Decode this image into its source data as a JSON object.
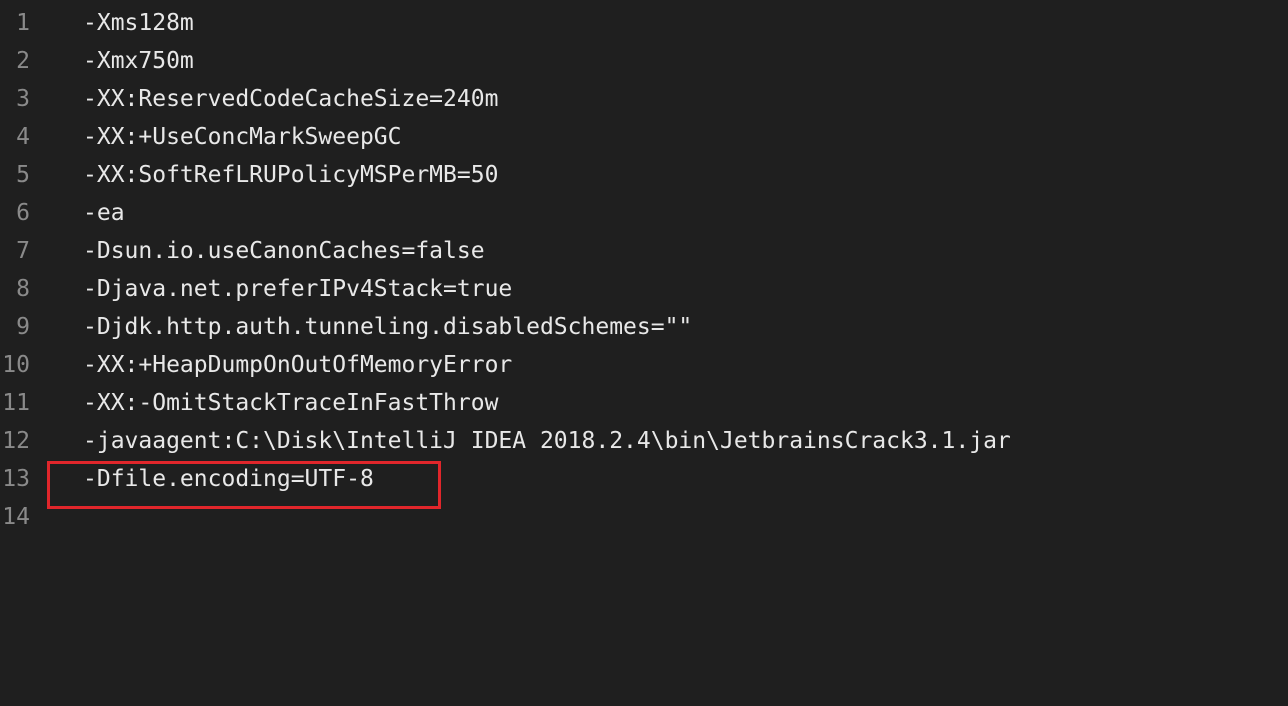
{
  "editor": {
    "lines": [
      {
        "num": "1",
        "text": "-Xms128m"
      },
      {
        "num": "2",
        "text": "-Xmx750m"
      },
      {
        "num": "3",
        "text": "-XX:ReservedCodeCacheSize=240m"
      },
      {
        "num": "4",
        "text": "-XX:+UseConcMarkSweepGC"
      },
      {
        "num": "5",
        "text": "-XX:SoftRefLRUPolicyMSPerMB=50"
      },
      {
        "num": "6",
        "text": "-ea"
      },
      {
        "num": "7",
        "text": "-Dsun.io.useCanonCaches=false"
      },
      {
        "num": "8",
        "text": "-Djava.net.preferIPv4Stack=true"
      },
      {
        "num": "9",
        "text": "-Djdk.http.auth.tunneling.disabledSchemes=\"\""
      },
      {
        "num": "10",
        "text": "-XX:+HeapDumpOnOutOfMemoryError"
      },
      {
        "num": "11",
        "text": "-XX:-OmitStackTraceInFastThrow"
      },
      {
        "num": "12",
        "text": "-javaagent:C:\\Disk\\IntelliJ IDEA 2018.2.4\\bin\\JetbrainsCrack3.1.jar"
      },
      {
        "num": "13",
        "text": "-Dfile.encoding=UTF-8"
      },
      {
        "num": "14",
        "text": ""
      }
    ],
    "highlight_color": "#e0262b",
    "background": "#1f1f1f"
  }
}
